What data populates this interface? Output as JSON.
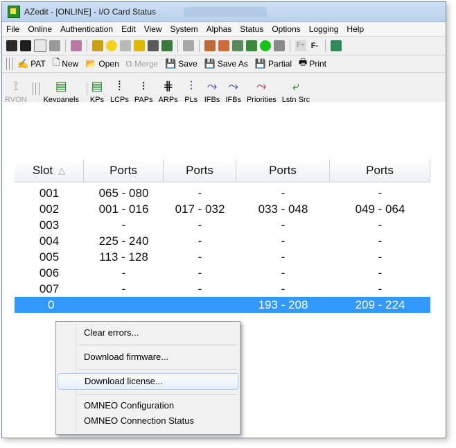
{
  "window": {
    "title": "AZedit - [ONLINE] - I/O Card Status"
  },
  "menu": [
    "File",
    "Online",
    "Authentication",
    "Edit",
    "View",
    "System",
    "Alphas",
    "Status",
    "Options",
    "Logging",
    "Help"
  ],
  "toolbar2": {
    "pat": "PAT",
    "new": "New",
    "open": "Open",
    "merge": "Merge",
    "save": "Save",
    "save_as": "Save As",
    "partial": "Partial",
    "print": "Print"
  },
  "toolbar3": {
    "rvon": "RVON",
    "keypanels": "Keypanels",
    "kps": "KPs",
    "lcps": "LCPs",
    "paps": "PAPs",
    "arps": "ARPs",
    "pls": "PLs",
    "ifbs1": "IFBs",
    "ifbs2": "IFBs",
    "priorities": "Priorities",
    "lstn": "Lstn Src"
  },
  "table": {
    "columns": [
      "Slot",
      "Ports",
      "Ports",
      "Ports",
      "Ports"
    ],
    "rows": [
      [
        "001",
        "065 - 080",
        "-",
        "-",
        "-"
      ],
      [
        "002",
        "001 - 016",
        "017 - 032",
        "033 - 048",
        "049 - 064"
      ],
      [
        "003",
        "-",
        "-",
        "-",
        "-"
      ],
      [
        "004",
        "225 - 240",
        "-",
        "-",
        "-"
      ],
      [
        "005",
        "113 - 128",
        "-",
        "-",
        "-"
      ],
      [
        "006",
        "-",
        "-",
        "-",
        "-"
      ],
      [
        "007",
        "-",
        "-",
        "-",
        "-"
      ],
      [
        "0",
        "",
        "",
        "193 - 208",
        "209 - 224"
      ]
    ]
  },
  "context_menu": {
    "clear_errors": "Clear errors...",
    "download_firmware": "Download firmware...",
    "download_license": "Download license...",
    "omneo_config": "OMNEO Configuration",
    "omneo_status": "OMNEO Connection Status"
  },
  "colors": {
    "selection": "#3399ff",
    "titlebar": "#c4d9f1"
  }
}
